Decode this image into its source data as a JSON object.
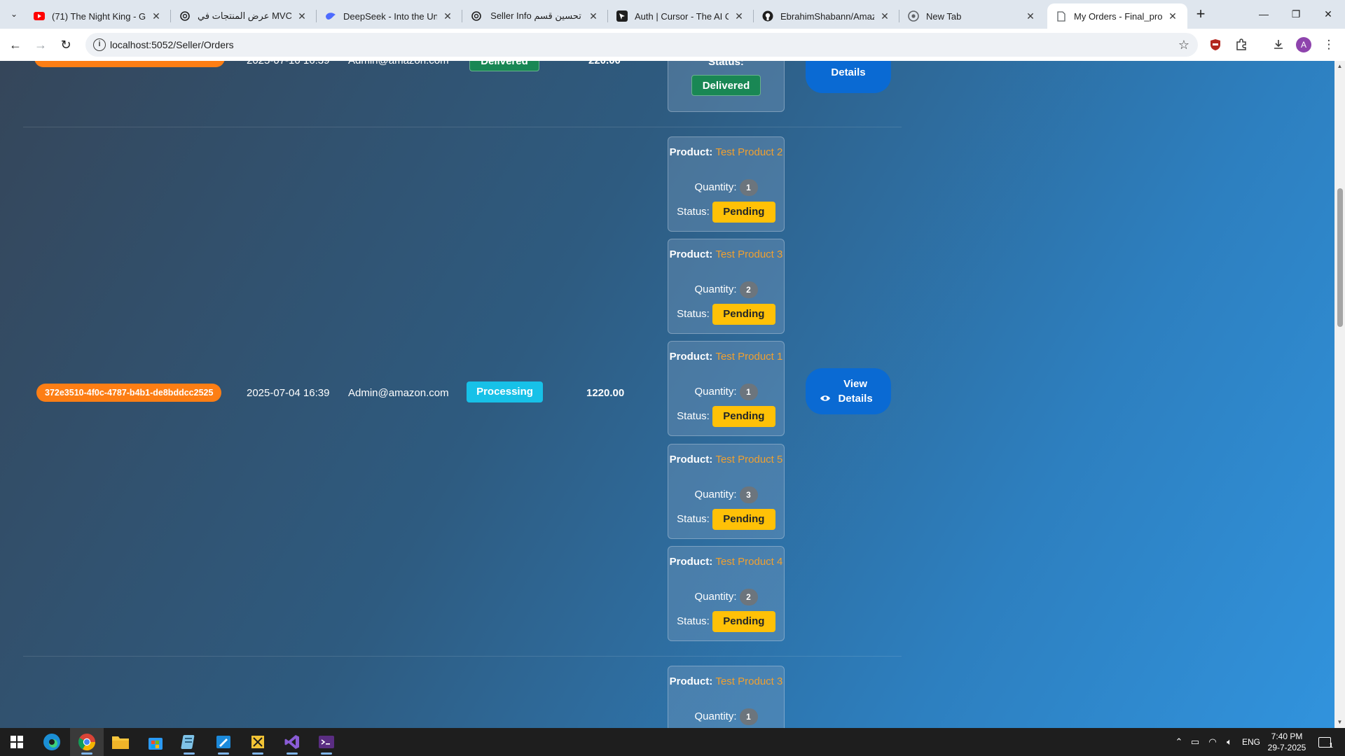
{
  "browser": {
    "tabs": [
      {
        "title": "(71) The Night King - Gam",
        "icon": "youtube-icon",
        "color": "#ff0000"
      },
      {
        "title": "عرض المنتجات في MVC",
        "icon": "openai-icon",
        "color": "#1f1f1f"
      },
      {
        "title": "DeepSeek - Into the Unkn",
        "icon": "deepseek-icon",
        "color": "#4d6bfe"
      },
      {
        "title": "Seller Info تحسين قسم",
        "icon": "openai-icon",
        "color": "#1f1f1f"
      },
      {
        "title": "Auth | Cursor - The AI Co",
        "icon": "cursor-icon",
        "color": "#1f1f1f"
      },
      {
        "title": "EbrahimShabann/Amazon",
        "icon": "github-icon",
        "color": "#1f1f1f"
      },
      {
        "title": "New Tab",
        "icon": "chrome-icon",
        "color": "#5f6368"
      },
      {
        "title": "My Orders - Final_project",
        "icon": "page-icon",
        "color": "#5f6368",
        "active": true
      }
    ],
    "url": "localhost:5052/Seller/Orders"
  },
  "orders": {
    "top_row": {
      "order_id": "f0e37b92-a403-46d7-b1d2-8445b054bb0d",
      "date": "2025-07-10 16:39",
      "email": "Admin@amazon.com",
      "status": "Delivered",
      "total": "220.00",
      "item_status_label": "Status:",
      "item_status": "Delivered",
      "view_label": "Details"
    },
    "middle_row": {
      "order_id": "372e3510-4f0c-4787-b4b1-de8bddcc2525",
      "date": "2025-07-04 16:39",
      "email": "Admin@amazon.com",
      "status": "Processing",
      "total": "1220.00",
      "view_label": "View Details",
      "items": [
        {
          "product_label": "Product:",
          "product": "Test Product 2",
          "qty_label": "Quantity:",
          "qty": "1",
          "status_label": "Status:",
          "status": "Pending"
        },
        {
          "product_label": "Product:",
          "product": "Test Product 3",
          "qty_label": "Quantity:",
          "qty": "2",
          "status_label": "Status:",
          "status": "Pending"
        },
        {
          "product_label": "Product:",
          "product": "Test Product 1",
          "qty_label": "Quantity:",
          "qty": "1",
          "status_label": "Status:",
          "status": "Pending"
        },
        {
          "product_label": "Product:",
          "product": "Test Product 5",
          "qty_label": "Quantity:",
          "qty": "3",
          "status_label": "Status:",
          "status": "Pending"
        },
        {
          "product_label": "Product:",
          "product": "Test Product 4",
          "qty_label": "Quantity:",
          "qty": "2",
          "status_label": "Status:",
          "status": "Pending"
        }
      ]
    },
    "bottom_row": {
      "items": [
        {
          "product_label": "Product:",
          "product": "Test Product 3",
          "qty_label": "Quantity:",
          "qty": "1"
        }
      ]
    }
  },
  "taskbar": {
    "apps": [
      "start-icon",
      "edge-icon",
      "chrome-icon",
      "file-explorer-icon",
      "store-icon",
      "notepad-icon",
      "paint-icon",
      "sql-icon",
      "visual-studio-icon",
      "terminal-icon"
    ],
    "language": "ENG",
    "time": "7:40 PM",
    "date": "29-7-2025",
    "notification_count": "1"
  }
}
